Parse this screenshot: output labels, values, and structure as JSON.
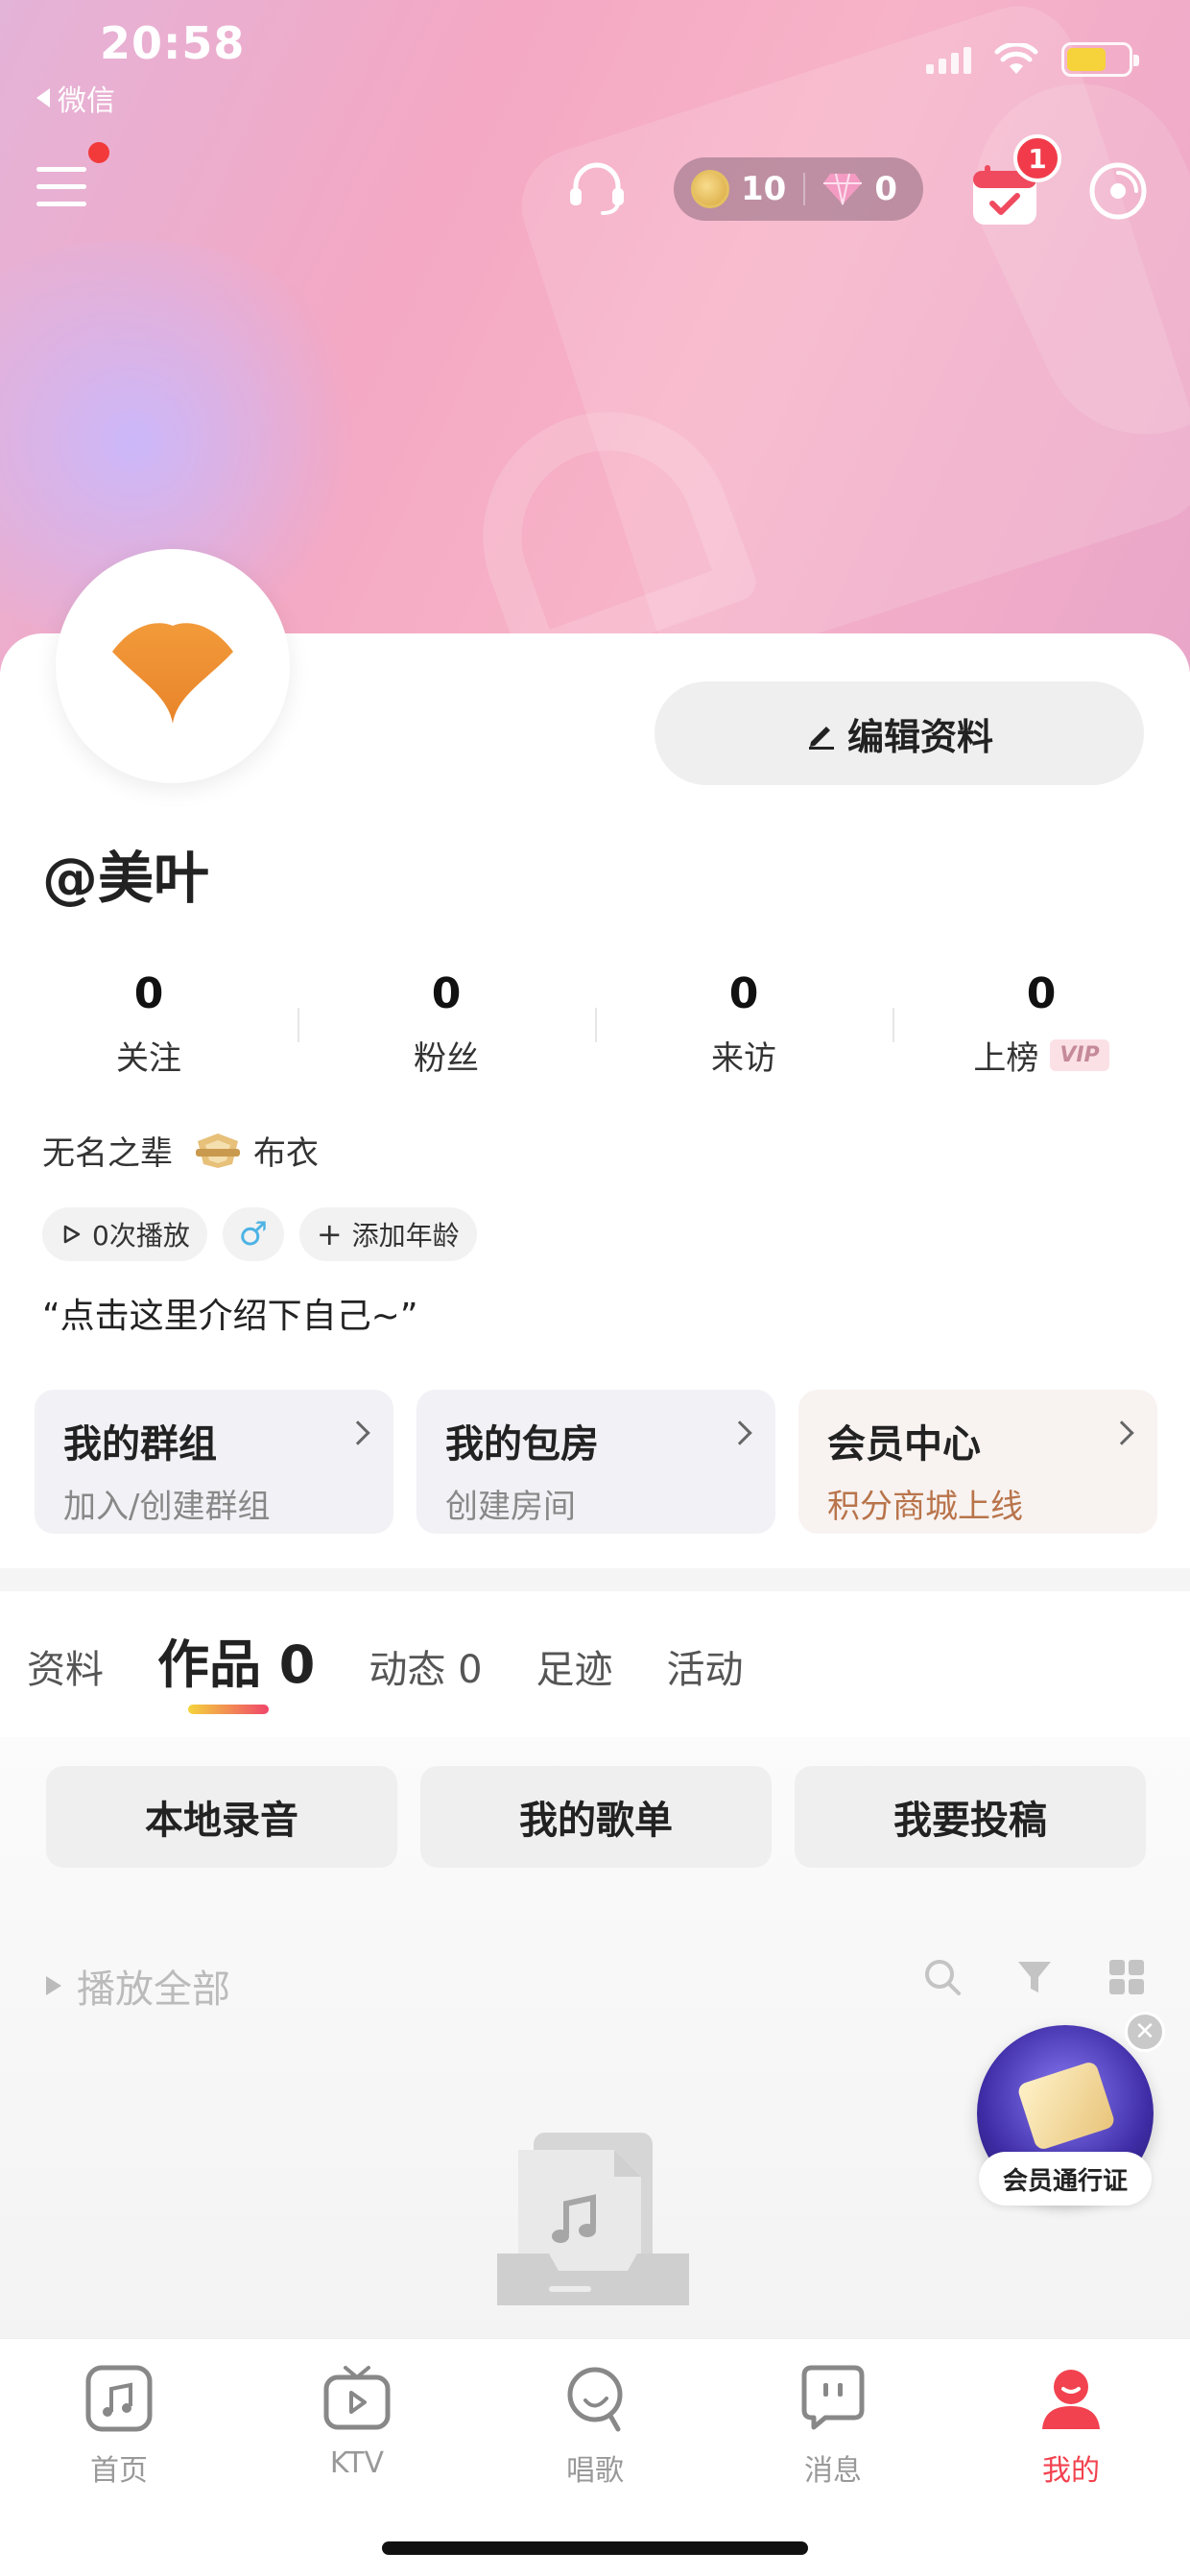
{
  "status_bar": {
    "time": "20:58",
    "back_label": "微信"
  },
  "header": {
    "coins": "10",
    "diamonds": "0",
    "calendar_badge": "1"
  },
  "profile": {
    "edit_label": "编辑资料",
    "username": "@美叶",
    "stats": [
      {
        "value": "0",
        "label": "关注"
      },
      {
        "value": "0",
        "label": "粉丝"
      },
      {
        "value": "0",
        "label": "来访"
      },
      {
        "value": "0",
        "label": "上榜",
        "badge": "VIP"
      }
    ],
    "title": "无名之辈",
    "rank": "布衣",
    "tags": {
      "plays": "0次播放",
      "gender": "♂",
      "add_age": "添加年龄"
    },
    "intro": "“点击这里介绍下自己~”"
  },
  "entries": [
    {
      "title": "我的群组",
      "subtitle": "加入/创建群组"
    },
    {
      "title": "我的包房",
      "subtitle": "创建房间"
    },
    {
      "title": "会员中心",
      "subtitle": "积分商城上线"
    }
  ],
  "tabs": [
    {
      "label": "资料"
    },
    {
      "label": "作品 0"
    },
    {
      "label": "动态 0"
    },
    {
      "label": "足迹"
    },
    {
      "label": "活动"
    }
  ],
  "actions": [
    "本地录音",
    "我的歌单",
    "我要投稿"
  ],
  "play_all": "播放全部",
  "promo": {
    "label": "会员通行证",
    "close": "✕"
  },
  "bottom_nav": [
    {
      "label": "首页",
      "icon": "music-note-icon"
    },
    {
      "label": "KTV",
      "icon": "tv-icon"
    },
    {
      "label": "唱歌",
      "icon": "sing-icon"
    },
    {
      "label": "消息",
      "icon": "message-icon"
    },
    {
      "label": "我的",
      "icon": "profile-icon",
      "active": true
    }
  ],
  "colors": {
    "accent": "#f2424f",
    "vip_text": "#b9744b",
    "brand_pink": "#f4a8c3"
  }
}
